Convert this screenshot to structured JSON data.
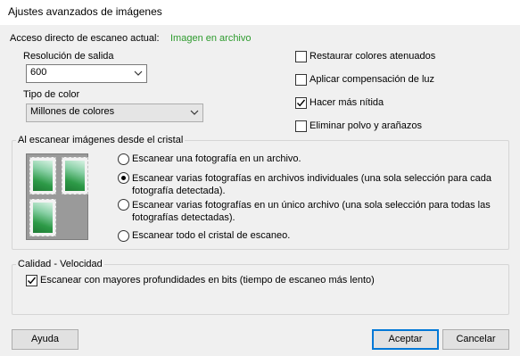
{
  "window": {
    "title": "Ajustes avanzados de imágenes"
  },
  "shortcut": {
    "label": "Acceso directo de escaneo actual:",
    "value": "Imagen en archivo",
    "value_color": "#2e9b2e"
  },
  "resolution": {
    "label": "Resolución de salida",
    "selected": "600"
  },
  "color_type": {
    "label": "Tipo de color",
    "selected": "Millones de colores"
  },
  "options": [
    {
      "label": "Restaurar colores atenuados",
      "checked": false
    },
    {
      "label": "Aplicar compensación de luz",
      "checked": false
    },
    {
      "label": "Hacer más nítida",
      "checked": true
    },
    {
      "label": "Eliminar polvo y arañazos",
      "checked": false
    }
  ],
  "glass_group": {
    "title": "Al escanear imágenes desde el cristal",
    "radios": [
      {
        "text": "Escanear una fotografía en un archivo.",
        "selected": false
      },
      {
        "line1": "Escanear varias fotografías en archivos individuales (una sola selección para cada",
        "line2": "fotografía detectada).",
        "selected": true
      },
      {
        "line1": "Escanear varias fotografías en un único archivo (una sola selección para todas las",
        "line2": "fotografías detectadas).",
        "selected": false
      },
      {
        "text": "Escanear todo el cristal de escaneo.",
        "selected": false
      }
    ]
  },
  "quality_group": {
    "title": "Calidad - Velocidad",
    "checkbox": {
      "label": "Escanear con mayores profundidades en bits (tiempo de escaneo más lento)",
      "checked": true
    }
  },
  "buttons": {
    "help": "Ayuda",
    "ok": "Aceptar",
    "cancel": "Cancelar"
  },
  "colors": {
    "dialog_bg": "#f0f0f0",
    "accent": "#0078d7",
    "status_green": "#2e9b2e"
  }
}
